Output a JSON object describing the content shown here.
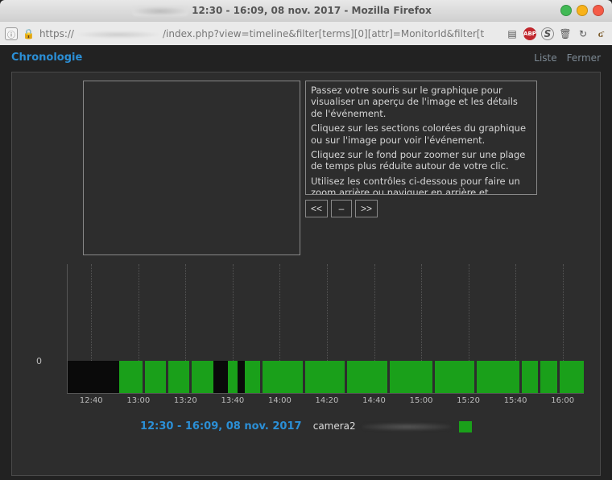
{
  "window": {
    "title": "12:30 - 16:09, 08 nov. 2017 - Mozilla Firefox"
  },
  "urlbar": {
    "scheme": "https",
    "path": "/index.php?view=timeline&filter[terms][0][attr]=MonitorId&filter[t"
  },
  "header": {
    "crumb": "Chronologie",
    "links": {
      "list": "Liste",
      "close": "Fermer"
    }
  },
  "info": {
    "p1": "Passez votre souris sur le graphique pour visualiser un aperçu de l'image et les détails de l'événement.",
    "p2": "Cliquez sur les sections colorées du graphique ou sur l'image pour voir l'événement.",
    "p3": "Cliquez sur le fond pour zoomer sur une plage de temps plus réduite autour de votre clic.",
    "p4": "Utilisez les contrôles ci-dessous pour faire un zoom arrière ou naviguer en arrière et                     intervalle de temps."
  },
  "nav": {
    "prev": "<<",
    "zoomout": "–",
    "next": ">>"
  },
  "legend": {
    "range": "12:30 - 16:09, 08 nov. 2017",
    "camera": "camera2"
  },
  "chart_data": {
    "type": "bar",
    "ylabel": "0",
    "x_ticks": [
      "12:40",
      "13:00",
      "13:20",
      "13:40",
      "14:00",
      "14:20",
      "14:40",
      "15:00",
      "15:20",
      "15:40",
      "16:00"
    ],
    "x_tick_minutes": [
      10,
      30,
      50,
      70,
      90,
      110,
      130,
      150,
      170,
      190,
      210
    ],
    "x_range_minutes": [
      0,
      219
    ],
    "segments": [
      {
        "start": 0,
        "end": 22,
        "state": "off"
      },
      {
        "start": 22,
        "end": 62,
        "state": "on"
      },
      {
        "start": 62,
        "end": 68,
        "state": "off"
      },
      {
        "start": 68,
        "end": 72,
        "state": "on"
      },
      {
        "start": 72,
        "end": 75,
        "state": "off"
      },
      {
        "start": 75,
        "end": 219,
        "state": "on"
      }
    ],
    "gap_minutes": [
      32,
      42,
      52,
      82,
      100,
      118,
      136,
      155,
      173,
      192,
      200,
      208
    ]
  }
}
